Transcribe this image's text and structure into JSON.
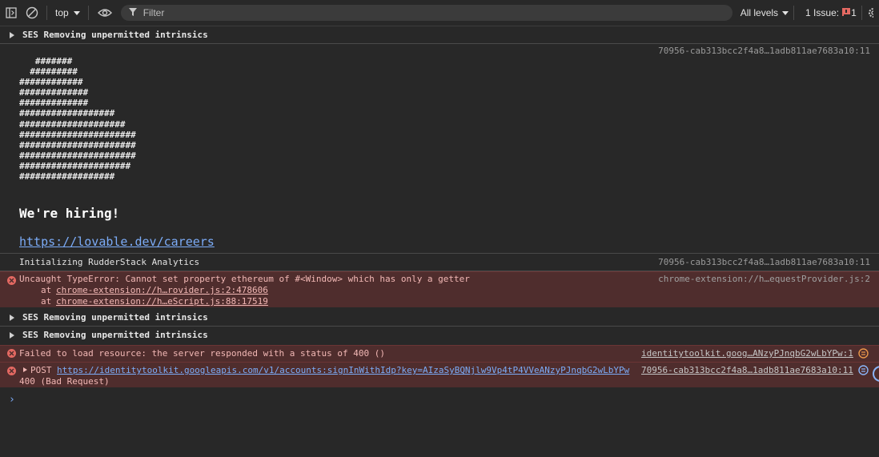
{
  "toolbar": {
    "context": "top",
    "filter_placeholder": "Filter",
    "levels": "All levels",
    "issues_label": "1 Issue:",
    "issues_count": "1"
  },
  "entries": {
    "ses1": "SES Removing unpermitted intrinsics",
    "src_hash": "70956-cab313bcc2f4a8…1adb811ae7683a10:11",
    "ascii_art": "   #######\n  #########\n############\n#############\n#############\n##################\n####################\n######################\n######################\n######################\n#####################\n##################",
    "hiring": "We're hiring!",
    "careers_url": "https://lovable.dev/careers",
    "rudder": "Initializing RudderStack Analytics",
    "rudder_src": "70956-cab313bcc2f4a8…1adb811ae7683a10:11",
    "typeerror": "Uncaught TypeError: Cannot set property ethereum of #<Window> which has only a getter",
    "typeerror_src": "chrome-extension://h…equestProvider.js:2",
    "stack1_prefix": "at",
    "stack1_link": "chrome-extension://h…rovider.js:2:478606",
    "stack2_prefix": "at",
    "stack2_link": "chrome-extension://h…eScript.js:88:17519",
    "ses2": "SES Removing unpermitted intrinsics",
    "ses3": "SES Removing unpermitted intrinsics",
    "failed": "Failed to load resource: the server responded with a status of 400 ()",
    "failed_src": "identitytoolkit.goog…ANzyPJnqbG2wLbYPw:1",
    "post_method": "POST",
    "post_url": "https://identitytoolkit.googleapis.com/v1/accounts:signInWithIdp?key=AIzaSyBQNjlw9Vp4tP4VVeANzyPJnqbG2wLbYPw",
    "post_status": "400 (Bad Request)",
    "post_src": "70956-cab313bcc2f4a8…1adb811ae7683a10:11"
  },
  "colors": {
    "background": "#282828",
    "error_bg": "#4f2d2d",
    "error_text": "#f2b8b5",
    "link": "#7cacf8",
    "error_icon": "#e46962"
  }
}
